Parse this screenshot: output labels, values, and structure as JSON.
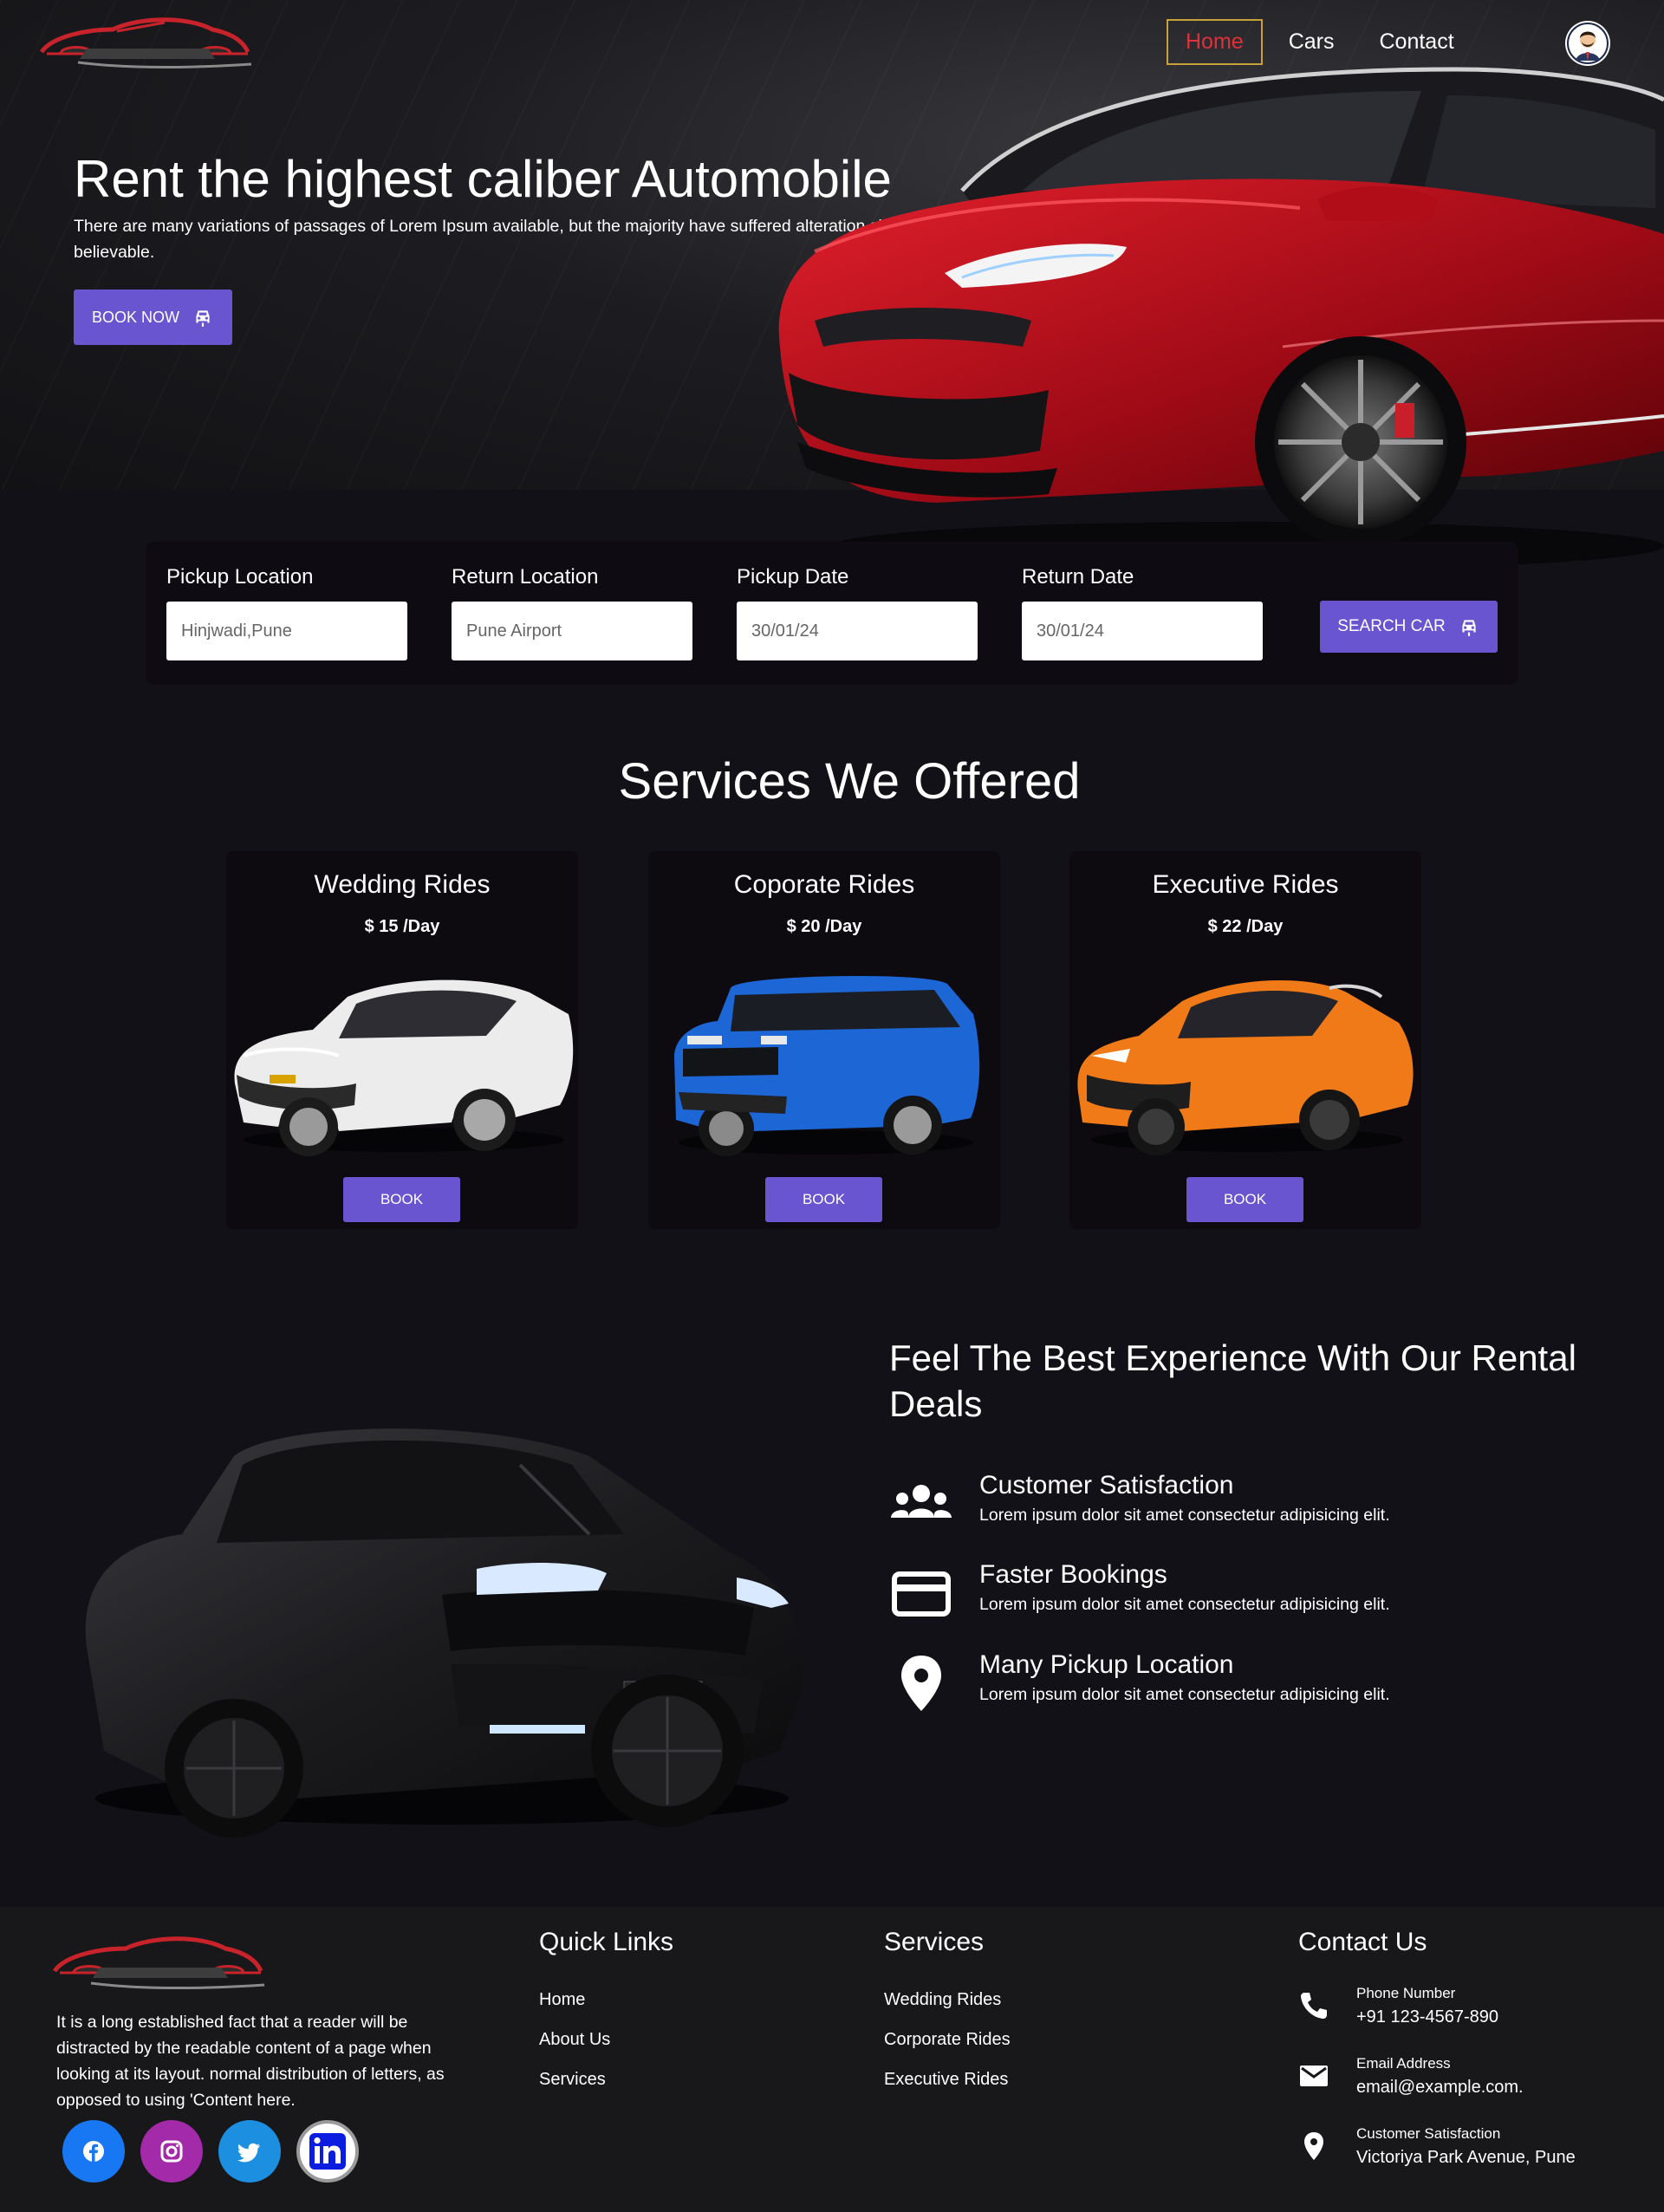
{
  "nav": {
    "items": [
      {
        "label": "Home",
        "active": true
      },
      {
        "label": "Cars",
        "active": false
      },
      {
        "label": "Contact",
        "active": false
      }
    ]
  },
  "hero": {
    "title": "Rent the highest caliber Automobile",
    "subtitle": "There are many variations of passages of Lorem Ipsum available, but the majority have suffered alteration slightly believable.",
    "book_now_label": "BOOK NOW"
  },
  "search": {
    "pickup_location_label": "Pickup Location",
    "pickup_location_value": "Hinjwadi,Pune",
    "return_location_label": "Return Location",
    "return_location_value": "Pune Airport",
    "pickup_date_label": "Pickup Date",
    "pickup_date_value": "30/01/24",
    "return_date_label": "Return Date",
    "return_date_value": "30/01/24",
    "button_label": "SEARCH CAR"
  },
  "services": {
    "title": "Services We Offered",
    "cards": [
      {
        "title": "Wedding Rides",
        "price": "$ 15 /Day",
        "button": "BOOK",
        "car_color": "#f2f2f2"
      },
      {
        "title": "Coporate Rides",
        "price": "$ 20 /Day",
        "button": "BOOK",
        "car_color": "#1f6fe0"
      },
      {
        "title": "Executive Rides",
        "price": "$ 22 /Day",
        "button": "BOOK",
        "car_color": "#f07a18"
      }
    ]
  },
  "experience": {
    "title": "Feel The Best Experience With Our Rental Deals",
    "features": [
      {
        "title": "Customer Satisfaction",
        "desc": "Lorem ipsum dolor sit amet consectetur adipisicing elit.",
        "icon": "people-icon"
      },
      {
        "title": "Faster Bookings",
        "desc": "Lorem ipsum dolor sit amet consectetur adipisicing elit.",
        "icon": "credit-card-icon"
      },
      {
        "title": "Many Pickup Location",
        "desc": "Lorem ipsum dolor sit amet consectetur adipisicing elit.",
        "icon": "location-pin-icon"
      }
    ]
  },
  "footer": {
    "about": "It is a long established fact that a reader will be distracted by the readable content of a page when looking at its layout. normal distribution of letters, as opposed to using 'Content here.",
    "quick_links": {
      "heading": "Quick Links",
      "items": [
        "Home",
        "About Us",
        "Services"
      ]
    },
    "services": {
      "heading": "Services",
      "items": [
        "Wedding Rides",
        "Corporate Rides",
        "Executive Rides"
      ]
    },
    "contact": {
      "heading": "Contact Us",
      "rows": [
        {
          "label": "Phone Number",
          "value": "+91 123-4567-890",
          "icon": "phone-icon"
        },
        {
          "label": "Email Address",
          "value": "email@example.com.",
          "icon": "mail-icon"
        },
        {
          "label": "Customer Satisfaction",
          "value": "Victoriya Park Avenue, Pune",
          "icon": "location-pin-icon"
        }
      ]
    },
    "socials": [
      {
        "name": "facebook-icon",
        "color": "#1877f2"
      },
      {
        "name": "instagram-icon",
        "color": "#a32aa8"
      },
      {
        "name": "twitter-icon",
        "color": "#1d8fe0"
      },
      {
        "name": "linkedin-icon",
        "color": "#ffffff"
      }
    ]
  },
  "colors": {
    "accent": "#6a55d0",
    "background": "#131118",
    "footer_bg": "#18181b",
    "active_nav_border": "#c8a13a",
    "active_nav_text": "#e0303a"
  }
}
